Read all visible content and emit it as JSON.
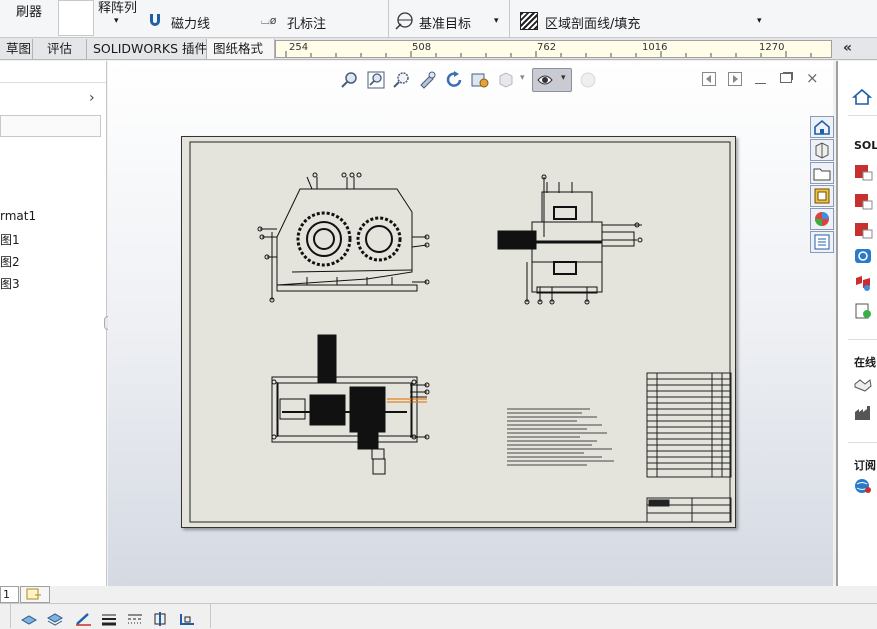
{
  "ribbon": {
    "refresh_label": "刷器",
    "array_label": "释阵列",
    "magnetic_line": "磁力线",
    "hole_callout": "孔标注",
    "datum_target": "基准目标",
    "area_hatch": "区域剖面线/填充"
  },
  "tabs": [
    "草图",
    "评估",
    "SOLIDWORKS 插件",
    "图纸格式"
  ],
  "ruler": {
    "ticks": [
      "254",
      "508",
      "762",
      "1016",
      "1270"
    ]
  },
  "tree": {
    "items": [
      "rmat1",
      "图1",
      "图2",
      "图3"
    ]
  },
  "task_pane": {
    "section_solid": "SOLI",
    "section_online": "在线",
    "section_subscribe": "订阅"
  },
  "bottom": {
    "sheet_tab": "1"
  },
  "icons": {
    "home": "home-icon",
    "collapse": "double-chevron-left-icon",
    "zoom": "magnifier-icon",
    "rotate": "rotate-icon",
    "close": "close-icon"
  },
  "colors": {
    "sheet": "#e4e4dc",
    "canvas_top": "#ffffff",
    "canvas_bottom": "#d4d9e2",
    "accent": "#1f5fa8"
  }
}
